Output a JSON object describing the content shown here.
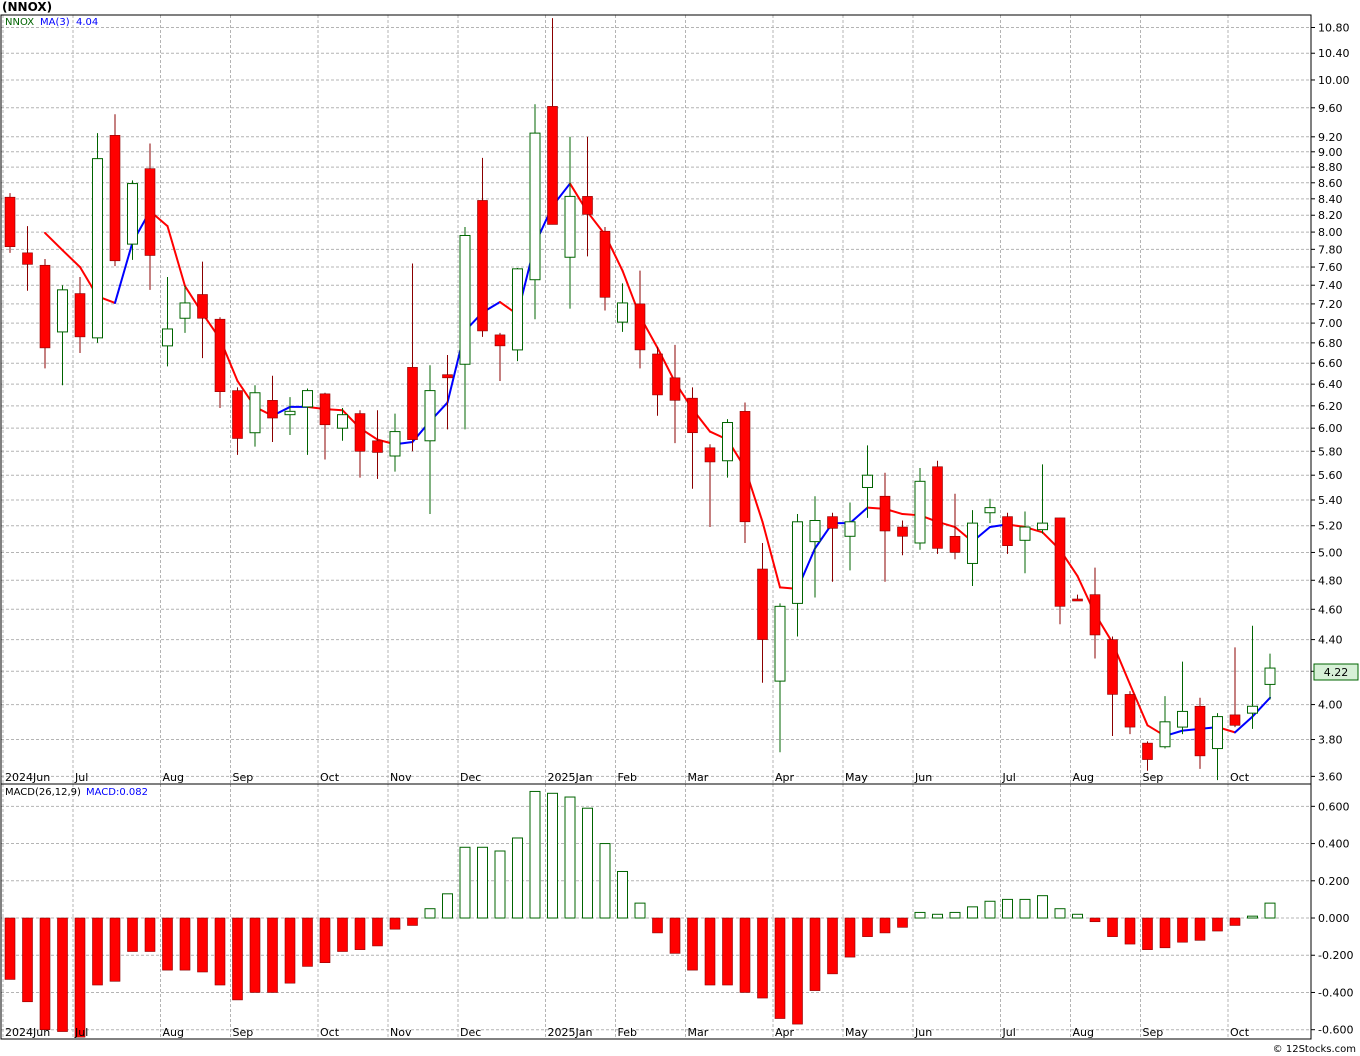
{
  "header": {
    "symbol_title": "(NNOX)",
    "legend_symbol": "NNOX",
    "legend_ma": "MA(3)",
    "legend_ma_value": "4.04",
    "legend_macd": "MACD(26,12,9)",
    "legend_macd_value": "MACD:0.082",
    "last_price": "4.22",
    "watermark": "© 12Stocks.com"
  },
  "colors": {
    "up": "#006400",
    "down": "#ff0000",
    "ma_up": "#0000ff",
    "ma_down": "#ff0000",
    "price_tag_bg": "#d7f0d7"
  },
  "chart_data": [
    {
      "type": "candlestick",
      "y_scale": "log",
      "ylim": [
        3.56,
        11.0
      ],
      "y_ticks": [
        "10.80",
        "10.40",
        "10.00",
        "9.60",
        "9.20",
        "9.00",
        "8.80",
        "8.60",
        "8.40",
        "8.20",
        "8.00",
        "7.80",
        "7.60",
        "7.40",
        "7.20",
        "7.00",
        "6.80",
        "6.60",
        "6.40",
        "6.20",
        "6.00",
        "5.80",
        "5.60",
        "5.40",
        "5.20",
        "5.00",
        "4.80",
        "4.60",
        "4.40",
        "4.20",
        "4.00",
        "3.80",
        "3.60"
      ],
      "x_labels": [
        {
          "i": 0,
          "t": "2024Jun"
        },
        {
          "i": 4,
          "t": "Jul"
        },
        {
          "i": 9,
          "t": "Aug"
        },
        {
          "i": 13,
          "t": "Sep"
        },
        {
          "i": 18,
          "t": "Oct"
        },
        {
          "i": 22,
          "t": "Nov"
        },
        {
          "i": 26,
          "t": "Dec"
        },
        {
          "i": 31,
          "t": "2025Jan"
        },
        {
          "i": 35,
          "t": "Feb"
        },
        {
          "i": 39,
          "t": "Mar"
        },
        {
          "i": 44,
          "t": "Apr"
        },
        {
          "i": 48,
          "t": "May"
        },
        {
          "i": 52,
          "t": "Jun"
        },
        {
          "i": 57,
          "t": "Jul"
        },
        {
          "i": 61,
          "t": "Aug"
        },
        {
          "i": 65,
          "t": "Sep"
        },
        {
          "i": 70,
          "t": "Oct"
        }
      ],
      "candles": [
        {
          "o": 8.42,
          "h": 8.47,
          "l": 7.76,
          "c": 7.83
        },
        {
          "o": 7.76,
          "h": 8.07,
          "l": 7.34,
          "c": 7.63
        },
        {
          "o": 7.62,
          "h": 7.69,
          "l": 6.55,
          "c": 6.75
        },
        {
          "o": 6.91,
          "h": 7.4,
          "l": 6.39,
          "c": 7.35
        },
        {
          "o": 7.31,
          "h": 7.49,
          "l": 6.7,
          "c": 6.86
        },
        {
          "o": 6.85,
          "h": 9.25,
          "l": 6.8,
          "c": 8.91
        },
        {
          "o": 9.22,
          "h": 9.51,
          "l": 7.61,
          "c": 7.67
        },
        {
          "o": 7.86,
          "h": 8.63,
          "l": 7.68,
          "c": 8.59
        },
        {
          "o": 8.78,
          "h": 9.11,
          "l": 7.35,
          "c": 7.73
        },
        {
          "o": 6.77,
          "h": 7.49,
          "l": 6.57,
          "c": 6.94
        },
        {
          "o": 7.05,
          "h": 7.39,
          "l": 6.9,
          "c": 7.21
        },
        {
          "o": 7.3,
          "h": 7.66,
          "l": 6.65,
          "c": 7.05
        },
        {
          "o": 7.04,
          "h": 7.06,
          "l": 6.18,
          "c": 6.33
        },
        {
          "o": 6.34,
          "h": 6.37,
          "l": 5.77,
          "c": 5.91
        },
        {
          "o": 5.96,
          "h": 6.39,
          "l": 5.84,
          "c": 6.32
        },
        {
          "o": 6.25,
          "h": 6.48,
          "l": 5.88,
          "c": 6.09
        },
        {
          "o": 6.12,
          "h": 6.28,
          "l": 5.94,
          "c": 6.15
        },
        {
          "o": 6.19,
          "h": 6.36,
          "l": 5.77,
          "c": 6.34
        },
        {
          "o": 6.31,
          "h": 6.32,
          "l": 5.73,
          "c": 6.03
        },
        {
          "o": 6.0,
          "h": 6.18,
          "l": 5.89,
          "c": 6.12
        },
        {
          "o": 6.13,
          "h": 6.16,
          "l": 5.58,
          "c": 5.8
        },
        {
          "o": 5.89,
          "h": 6.16,
          "l": 5.57,
          "c": 5.79
        },
        {
          "o": 5.76,
          "h": 6.13,
          "l": 5.63,
          "c": 5.97
        },
        {
          "o": 6.56,
          "h": 7.64,
          "l": 5.8,
          "c": 5.9
        },
        {
          "o": 5.89,
          "h": 6.58,
          "l": 5.29,
          "c": 6.34
        },
        {
          "o": 6.49,
          "h": 6.68,
          "l": 5.99,
          "c": 6.46
        },
        {
          "o": 6.59,
          "h": 8.06,
          "l": 5.99,
          "c": 7.96
        },
        {
          "o": 8.38,
          "h": 8.92,
          "l": 6.86,
          "c": 6.92
        },
        {
          "o": 6.88,
          "h": 6.9,
          "l": 6.43,
          "c": 6.77
        },
        {
          "o": 6.73,
          "h": 7.59,
          "l": 6.62,
          "c": 7.58
        },
        {
          "o": 7.46,
          "h": 9.65,
          "l": 7.04,
          "c": 9.25
        },
        {
          "o": 9.62,
          "h": 10.95,
          "l": 8.09,
          "c": 8.09
        },
        {
          "o": 7.71,
          "h": 9.2,
          "l": 7.15,
          "c": 8.43
        },
        {
          "o": 8.43,
          "h": 9.2,
          "l": 7.72,
          "c": 8.21
        },
        {
          "o": 8.01,
          "h": 8.06,
          "l": 7.13,
          "c": 7.27
        },
        {
          "o": 7.01,
          "h": 7.42,
          "l": 6.91,
          "c": 7.21
        },
        {
          "o": 7.2,
          "h": 7.56,
          "l": 6.55,
          "c": 6.73
        },
        {
          "o": 6.69,
          "h": 6.76,
          "l": 6.11,
          "c": 6.3
        },
        {
          "o": 6.46,
          "h": 6.78,
          "l": 5.87,
          "c": 6.25
        },
        {
          "o": 6.27,
          "h": 6.37,
          "l": 5.49,
          "c": 5.96
        },
        {
          "o": 5.83,
          "h": 5.86,
          "l": 5.19,
          "c": 5.71
        },
        {
          "o": 5.72,
          "h": 6.08,
          "l": 5.58,
          "c": 6.05
        },
        {
          "o": 6.15,
          "h": 6.23,
          "l": 5.07,
          "c": 5.23
        },
        {
          "o": 4.88,
          "h": 5.07,
          "l": 4.13,
          "c": 4.4
        },
        {
          "o": 4.14,
          "h": 4.64,
          "l": 3.73,
          "c": 4.62
        },
        {
          "o": 4.64,
          "h": 5.29,
          "l": 4.42,
          "c": 5.23
        },
        {
          "o": 5.08,
          "h": 5.43,
          "l": 4.68,
          "c": 5.24
        },
        {
          "o": 5.27,
          "h": 5.3,
          "l": 4.79,
          "c": 5.18
        },
        {
          "o": 5.12,
          "h": 5.38,
          "l": 4.87,
          "c": 5.23
        },
        {
          "o": 5.5,
          "h": 5.85,
          "l": 5.26,
          "c": 5.6
        },
        {
          "o": 5.43,
          "h": 5.62,
          "l": 4.79,
          "c": 5.16
        },
        {
          "o": 5.19,
          "h": 5.24,
          "l": 4.98,
          "c": 5.12
        },
        {
          "o": 5.07,
          "h": 5.66,
          "l": 5.02,
          "c": 5.55
        },
        {
          "o": 5.67,
          "h": 5.72,
          "l": 4.99,
          "c": 5.03
        },
        {
          "o": 5.12,
          "h": 5.45,
          "l": 4.95,
          "c": 5.0
        },
        {
          "o": 4.92,
          "h": 5.32,
          "l": 4.76,
          "c": 5.22
        },
        {
          "o": 5.3,
          "h": 5.41,
          "l": 5.22,
          "c": 5.34
        },
        {
          "o": 5.27,
          "h": 5.3,
          "l": 4.99,
          "c": 5.05
        },
        {
          "o": 5.09,
          "h": 5.31,
          "l": 4.85,
          "c": 5.19
        },
        {
          "o": 5.17,
          "h": 5.69,
          "l": 5.14,
          "c": 5.22
        },
        {
          "o": 5.26,
          "h": 5.26,
          "l": 4.5,
          "c": 4.62
        },
        {
          "o": 4.67,
          "h": 4.7,
          "l": 4.66,
          "c": 4.66
        },
        {
          "o": 4.7,
          "h": 4.89,
          "l": 4.28,
          "c": 4.43
        },
        {
          "o": 4.4,
          "h": 4.42,
          "l": 3.82,
          "c": 4.06
        },
        {
          "o": 4.06,
          "h": 4.08,
          "l": 3.83,
          "c": 3.87
        },
        {
          "o": 3.78,
          "h": 3.79,
          "l": 3.63,
          "c": 3.69
        },
        {
          "o": 3.76,
          "h": 4.05,
          "l": 3.75,
          "c": 3.9
        },
        {
          "o": 3.87,
          "h": 4.26,
          "l": 3.83,
          "c": 3.96
        },
        {
          "o": 3.99,
          "h": 4.04,
          "l": 3.64,
          "c": 3.71
        },
        {
          "o": 3.75,
          "h": 3.95,
          "l": 3.58,
          "c": 3.93
        },
        {
          "o": 3.94,
          "h": 4.35,
          "l": 3.87,
          "c": 3.88
        },
        {
          "o": 3.95,
          "h": 4.49,
          "l": 3.86,
          "c": 3.99
        },
        {
          "o": 4.12,
          "h": 4.31,
          "l": 4.03,
          "c": 4.22
        }
      ],
      "ma3": [
        null,
        null,
        7.99,
        7.79,
        7.6,
        7.28,
        7.21,
        7.88,
        8.25,
        8.07,
        7.39,
        7.1,
        6.84,
        6.43,
        6.19,
        6.11,
        6.19,
        6.19,
        6.17,
        6.16,
        6.0,
        5.9,
        5.86,
        5.88,
        6.06,
        6.23,
        6.92,
        7.11,
        7.22,
        7.09,
        7.86,
        8.31,
        8.59,
        8.24,
        7.97,
        7.56,
        7.07,
        6.75,
        6.42,
        6.17,
        5.97,
        5.9,
        5.66,
        5.23,
        4.75,
        4.74,
        5.03,
        5.22,
        5.22,
        5.34,
        5.33,
        5.29,
        5.28,
        5.23,
        5.19,
        5.08,
        5.19,
        5.21,
        5.19,
        5.15,
        5.02,
        4.83,
        4.57,
        4.38,
        4.12,
        3.88,
        3.82,
        3.85,
        3.86,
        3.87,
        3.84,
        3.93,
        4.04
      ]
    },
    {
      "type": "bar",
      "series": [
        {
          "name": "MACD(26,12,9)",
          "values": [
            -0.33,
            -0.45,
            -0.6,
            -0.61,
            -0.64,
            -0.36,
            -0.34,
            -0.18,
            -0.18,
            -0.28,
            -0.28,
            -0.29,
            -0.36,
            -0.44,
            -0.4,
            -0.4,
            -0.35,
            -0.26,
            -0.24,
            -0.18,
            -0.17,
            -0.15,
            -0.06,
            -0.04,
            0.05,
            0.13,
            0.38,
            0.38,
            0.36,
            0.43,
            0.68,
            0.67,
            0.65,
            0.59,
            0.4,
            0.25,
            0.08,
            -0.08,
            -0.19,
            -0.28,
            -0.36,
            -0.36,
            -0.4,
            -0.43,
            -0.54,
            -0.57,
            -0.39,
            -0.3,
            -0.21,
            -0.1,
            -0.08,
            -0.05,
            0.03,
            0.02,
            0.03,
            0.06,
            0.09,
            0.1,
            0.1,
            0.12,
            0.05,
            0.02,
            -0.02,
            -0.1,
            -0.14,
            -0.17,
            -0.16,
            -0.13,
            -0.12,
            -0.07,
            -0.04,
            0.01,
            0.08
          ]
        }
      ],
      "ylim": [
        -0.65,
        0.72
      ],
      "y_ticks": [
        "0.600",
        "0.400",
        "0.200",
        "0.000",
        "-0.200",
        "-0.400",
        "-0.600"
      ]
    }
  ]
}
